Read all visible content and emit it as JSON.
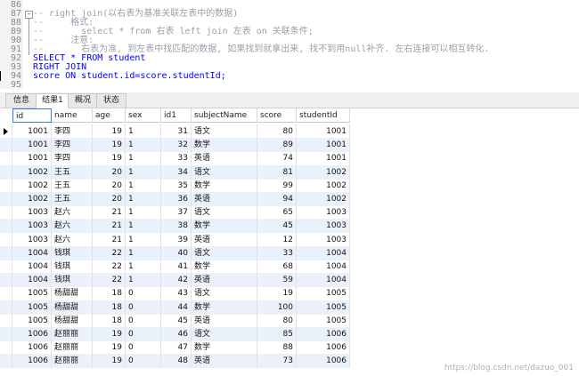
{
  "editor": {
    "lines": [
      {
        "num": "86",
        "text": ""
      },
      {
        "num": "87",
        "text": "-- right join(以右表为基准关联左表中的数据)"
      },
      {
        "num": "88",
        "text": "--     格式:"
      },
      {
        "num": "89",
        "text": "--       select * from 右表 left join 左表 on 关联条件;"
      },
      {
        "num": "90",
        "text": "--     注意:"
      },
      {
        "num": "91",
        "text": "--       右表为准, 到左表中找匹配的数据, 如果找到就拿出来, 找不到用null补齐. 左右连接可以相互转化."
      },
      {
        "num": "92",
        "text": "SELECT * FROM student"
      },
      {
        "num": "93",
        "text": "RIGHT JOIN"
      },
      {
        "num": "94",
        "text": "score ON student.id=score.studentId;"
      },
      {
        "num": "95",
        "text": ""
      }
    ]
  },
  "tabs": [
    "信息",
    "结果1",
    "概况",
    "状态"
  ],
  "grid": {
    "columns": [
      "id",
      "name",
      "age",
      "sex",
      "id1",
      "subjectName",
      "score",
      "studentId"
    ],
    "rows": [
      [
        "1001",
        "李四",
        "19",
        "1",
        "31",
        "语文",
        "80",
        "1001"
      ],
      [
        "1001",
        "李四",
        "19",
        "1",
        "32",
        "数学",
        "89",
        "1001"
      ],
      [
        "1001",
        "李四",
        "19",
        "1",
        "33",
        "英语",
        "74",
        "1001"
      ],
      [
        "1002",
        "王五",
        "20",
        "1",
        "34",
        "语文",
        "81",
        "1002"
      ],
      [
        "1002",
        "王五",
        "20",
        "1",
        "35",
        "数学",
        "99",
        "1002"
      ],
      [
        "1002",
        "王五",
        "20",
        "1",
        "36",
        "英语",
        "94",
        "1002"
      ],
      [
        "1003",
        "赵六",
        "21",
        "1",
        "37",
        "语文",
        "65",
        "1003"
      ],
      [
        "1003",
        "赵六",
        "21",
        "1",
        "38",
        "数学",
        "45",
        "1003"
      ],
      [
        "1003",
        "赵六",
        "21",
        "1",
        "39",
        "英语",
        "12",
        "1003"
      ],
      [
        "1004",
        "钱琪",
        "22",
        "1",
        "40",
        "语文",
        "33",
        "1004"
      ],
      [
        "1004",
        "钱琪",
        "22",
        "1",
        "41",
        "数学",
        "68",
        "1004"
      ],
      [
        "1004",
        "钱琪",
        "22",
        "1",
        "42",
        "英语",
        "59",
        "1004"
      ],
      [
        "1005",
        "杨甜甜",
        "18",
        "0",
        "43",
        "语文",
        "19",
        "1005"
      ],
      [
        "1005",
        "杨甜甜",
        "18",
        "0",
        "44",
        "数学",
        "100",
        "1005"
      ],
      [
        "1005",
        "杨甜甜",
        "18",
        "0",
        "45",
        "英语",
        "80",
        "1005"
      ],
      [
        "1006",
        "赵丽丽",
        "19",
        "0",
        "46",
        "语文",
        "85",
        "1006"
      ],
      [
        "1006",
        "赵丽丽",
        "19",
        "0",
        "47",
        "数学",
        "88",
        "1006"
      ],
      [
        "1006",
        "赵丽丽",
        "19",
        "0",
        "48",
        "英语",
        "73",
        "1006"
      ]
    ]
  },
  "watermark": "https://blog.csdn.net/dazuo_001",
  "colors": {
    "keyword": "#0000ff",
    "comment": "#9aa0a8",
    "alt_row": "#eaf1fb"
  }
}
